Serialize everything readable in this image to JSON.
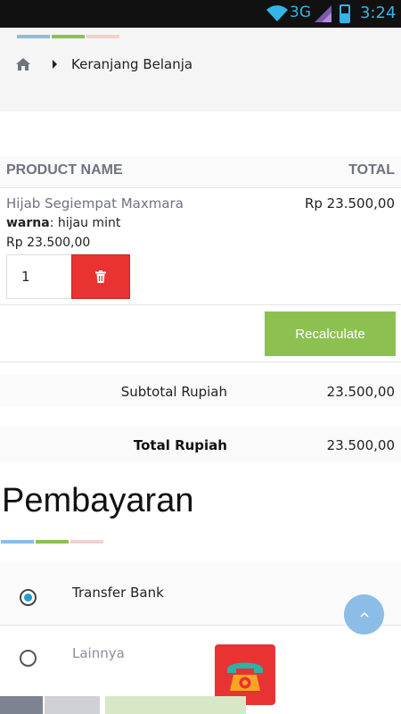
{
  "status_bar": {
    "network": "3G",
    "time": "3:24",
    "icons": [
      "wifi-icon",
      "signal-icon",
      "battery-icon"
    ]
  },
  "breadcrumb": {
    "home_icon": "home-icon",
    "current": "Keranjang Belanja"
  },
  "cart": {
    "headers": {
      "product": "PRODUCT NAME",
      "total": "TOTAL"
    },
    "item": {
      "name": "Hijab Segiempat Maxmara",
      "total": "Rp 23.500,00",
      "variant_label": "warna",
      "variant_value": ": hijau mint",
      "unit_price": "Rp 23.500,00",
      "quantity": "1"
    },
    "recalculate_label": "Recalculate",
    "subtotal_label": "Subtotal Rupiah",
    "subtotal_value": "23.500,00",
    "total_label": "Total Rupiah",
    "total_value": "23.500,00"
  },
  "payment": {
    "title": "Pembayaran",
    "options": [
      {
        "label": "Transfer Bank",
        "selected": true
      },
      {
        "label": "Lainnya",
        "selected": false
      }
    ]
  },
  "colors": {
    "accent_blue": "#8bbde6",
    "accent_green": "#8cc152",
    "accent_pink": "#f1d1cd",
    "danger_red": "#e93232",
    "radio_blue": "#1e9ec8"
  }
}
